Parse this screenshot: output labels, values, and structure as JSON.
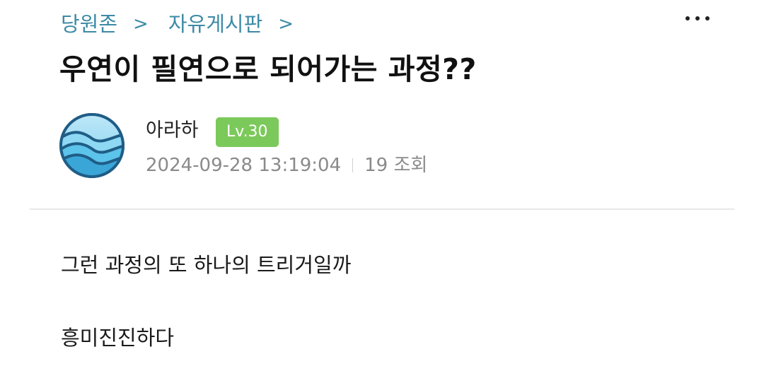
{
  "breadcrumb": {
    "items": [
      "당원존",
      "자유게시판"
    ],
    "separator": ">"
  },
  "header": {
    "more_icon": "more-horizontal-icon"
  },
  "post": {
    "title": "우연이 필연으로 되어가는 과정??",
    "author": {
      "name": "아라하",
      "level": "Lv.30",
      "avatar_icon": "wave-emblem-avatar"
    },
    "date": "2024-09-28 13:19:04",
    "views": "19 조회",
    "body": [
      "그런 과정의 또 하나의 트리거일까",
      "흥미진진하다"
    ]
  },
  "colors": {
    "breadcrumb": "#3d8aa6",
    "level_badge": "#7bc95a",
    "meta_text": "#8a8a8a",
    "divider": "#e8e8e8",
    "avatar_ring": "#1f5d86",
    "avatar_fill": "#5cc3ea"
  }
}
